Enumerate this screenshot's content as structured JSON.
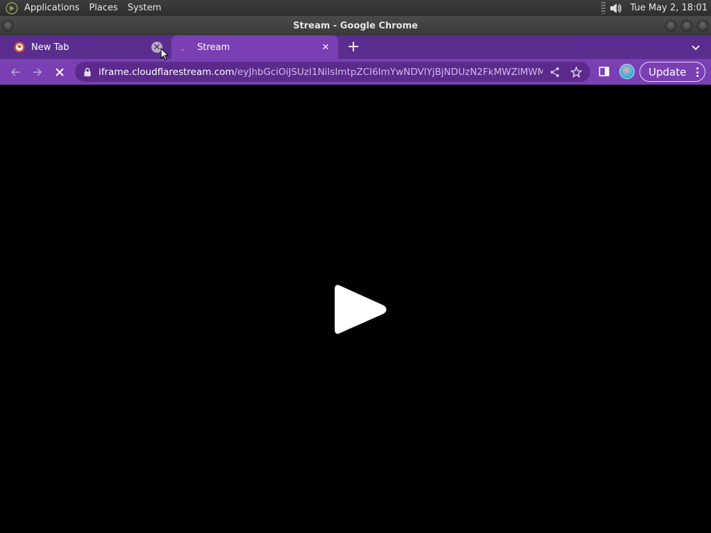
{
  "top_panel": {
    "menus": [
      "Applications",
      "Places",
      "System"
    ],
    "clock": "Tue May  2, 18:01",
    "icons": {
      "logo": "gnome-foot-icon",
      "volume": "volume-icon"
    }
  },
  "window": {
    "title": "Stream - Google Chrome"
  },
  "tabs": [
    {
      "title": "New Tab",
      "favicon": "duckduckgo-icon",
      "active": false
    },
    {
      "title": "Stream",
      "favicon": "loading-spinner-icon",
      "active": true
    }
  ],
  "toolbar": {
    "url_host": "iframe.cloudflarestream.com",
    "url_path": "/eyJhbGciOiJSUzI1NiIsImtpZCI6ImYwNDVlYjBjNDUzN2FkMWZlMWM…",
    "update_label": "Update",
    "icons": {
      "back": "back-arrow-icon",
      "forward": "forward-arrow-icon",
      "stop": "stop-icon",
      "lock": "lock-icon",
      "share": "share-icon",
      "bookmark": "star-icon",
      "side_panel": "side-panel-icon",
      "menu": "kebab-menu-icon"
    }
  },
  "content": {
    "background": "#000000",
    "play_icon": "play-icon"
  },
  "colors": {
    "tab_strip": "#5a2d8f",
    "toolbar": "#7b3fb4",
    "omnibox": "#5b2a8c"
  }
}
